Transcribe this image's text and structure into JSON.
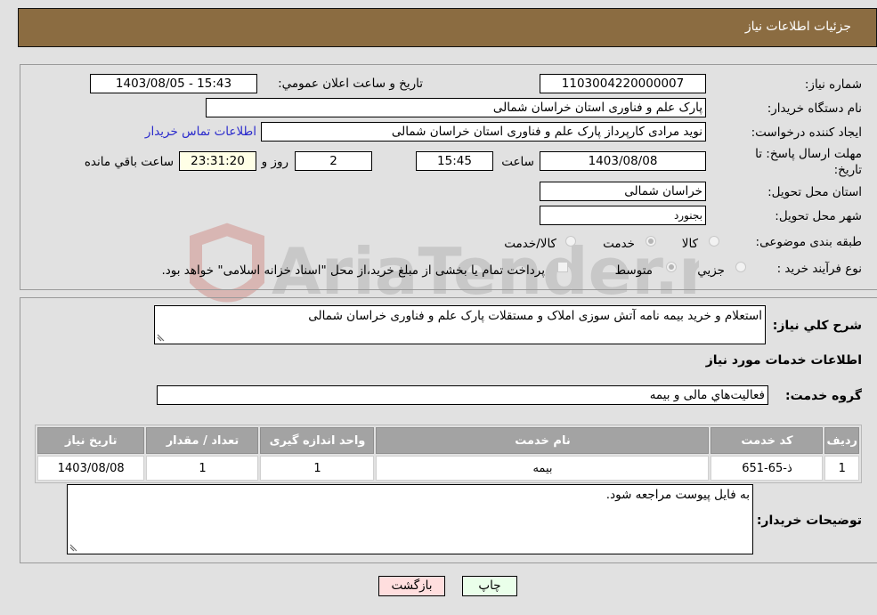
{
  "header": {
    "title": "جزئيات اطلاعات نياز"
  },
  "form": {
    "need_number_label": "شماره نياز:",
    "need_number": "1103004220000007",
    "announce_label": "تاريخ و ساعت اعلان عمومي:",
    "announce_value": "1403/08/05 - 15:43",
    "buyer_org_label": "نام دستگاه خريدار:",
    "buyer_org": "پارک علم و فناوری استان خراسان شمالی",
    "creator_label": "ايجاد کننده درخواست:",
    "creator": "نوید مرادی کارپرداز پارک علم و فناوری استان خراسان شمالی",
    "contact_link": "اطلاعات تماس خريدار",
    "deadline_label": "مهلت ارسال پاسخ: تا تاريخ:",
    "deadline_date": "1403/08/08",
    "time_label": "ساعت",
    "deadline_time": "15:45",
    "days_value": "2",
    "days_label": "روز و",
    "remaining_time": "23:31:20",
    "remaining_label": "ساعت باقي مانده",
    "province_label": "استان محل تحويل:",
    "province": "خراسان شمالی",
    "city_label": "شهر محل تحويل:",
    "city": "بجنورد",
    "category_label": "طبقه بندی موضوعی:",
    "category_options": [
      {
        "label": "کالا",
        "selected": false
      },
      {
        "label": "خدمت",
        "selected": true
      },
      {
        "label": "کالا/خدمت",
        "selected": false
      }
    ],
    "process_label": "نوع فرآيند خريد :",
    "process_options": [
      {
        "label": "جزيي",
        "selected": false
      },
      {
        "label": "متوسط",
        "selected": true
      }
    ],
    "treasury_note": "پرداخت تمام يا بخشی از مبلغ خريد،از محل \"اسناد خزانه اسلامی\" خواهد بود.",
    "treasury_checked": false
  },
  "details": {
    "summary_label": "شرح كلي نياز:",
    "summary": "استعلام و خرید بیمه نامه آتش سوزی املاک و مستقلات پارک علم و فناوری خراسان شمالی",
    "services_heading": "اطلاعات خدمات مورد نياز",
    "service_group_label": "گروه خدمت:",
    "service_group": "فعاليت‌هاي مالی و بيمه",
    "table": {
      "headers": [
        "رديف",
        "کد خدمت",
        "نام خدمت",
        "واحد اندازه گيری",
        "تعداد / مقدار",
        "تاريخ نياز"
      ],
      "rows": [
        [
          "1",
          "ذ-65-651",
          "بيمه",
          "1",
          "1",
          "1403/08/08"
        ]
      ]
    },
    "buyer_notes_label": "توضيحات خريدار:",
    "buyer_notes": "به فایل پیوست مراجعه شود."
  },
  "buttons": {
    "print": "چاپ",
    "back": "بازگشت"
  },
  "watermark": {
    "text": "AriaTender.neT"
  },
  "colors": {
    "header": "#8b6c41",
    "link": "#2a2acc",
    "print_bg": "#eaffea",
    "back_bg": "#ffdede",
    "remaining_bg": "#ffffe6"
  }
}
